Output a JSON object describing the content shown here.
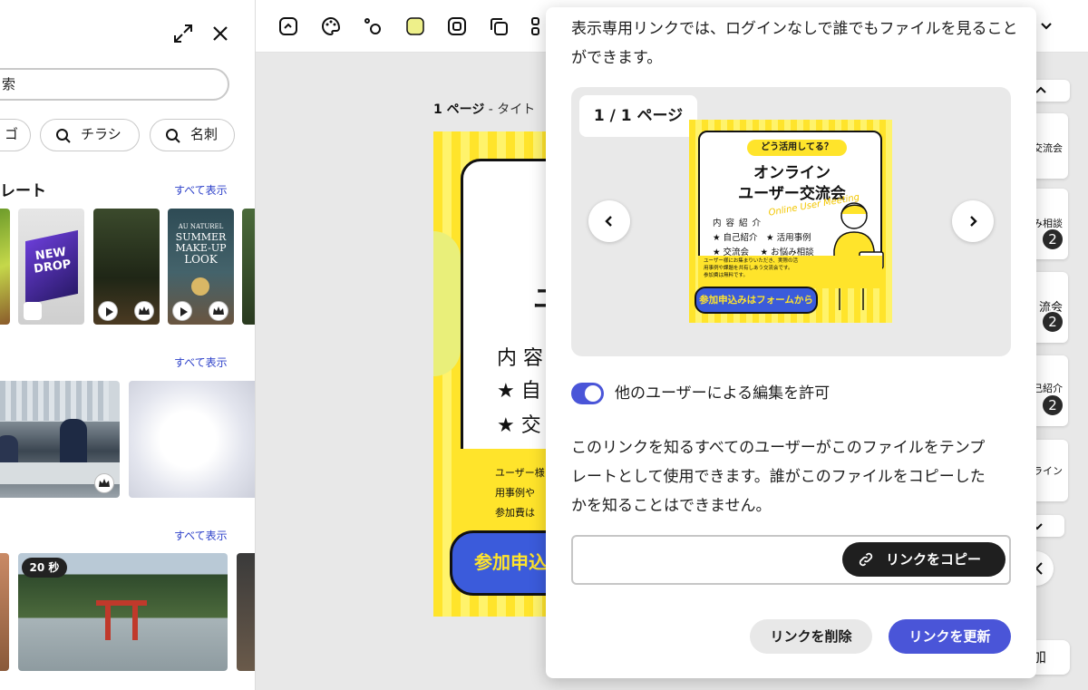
{
  "left_panel": {
    "search_value": "索",
    "chips": [
      "ゴ",
      "チラシ",
      "名刺"
    ],
    "sections": [
      {
        "title": "レート",
        "see_all": "すべて表示"
      },
      {
        "title": "",
        "see_all": "すべて表示"
      },
      {
        "title": "",
        "see_all": "すべて表示"
      }
    ],
    "thumbs": {
      "new_drop": "NEW DROP",
      "summer_1": "AU NATUREL",
      "summer_2": "SUMMER",
      "summer_3": "MAKE-UP",
      "summer_4": "LOOK",
      "video_duration": "20 秒"
    }
  },
  "canvas": {
    "page_label_bold": "1 ページ",
    "page_label_rest": " - タイト",
    "design_lines": [
      "内 容 紹",
      "★ 自",
      "★ 交"
    ],
    "design_small": [
      "ユーザー様",
      "用事例や",
      "参加費は"
    ],
    "design_button": "参加申込"
  },
  "pages_strip": {
    "items": [
      {
        "label": "ー交流会",
        "count": ""
      },
      {
        "label": "み相談",
        "count": "2"
      },
      {
        "label": "流会",
        "count": "2"
      },
      {
        "label": "己紹介",
        "count": "2"
      },
      {
        "label": "ライン",
        "count": ""
      }
    ],
    "add_label": "加"
  },
  "share_popover": {
    "intro_text": "表示専用リンクでは、ログインなしで誰でもファイルを見ることができます。",
    "page_indicator": "1 / 1 ページ",
    "flyer": {
      "tag": "どう活用してる？",
      "title_line1": "オンライン",
      "title_line2": "ユーザー交流会",
      "subtitle": "Online User Meeting",
      "section": "内 容 紹 介",
      "items_line1": "★ 自己紹介　★ 活用事例",
      "items_line2": "★ 交流会　 ★ お悩み相談",
      "desc_line1": "ユーザー様にお集まりいただき、実際の活",
      "desc_line2": "用事例や課題を共有しあう交流会です。",
      "desc_line3": "参加費は無料です。",
      "button": "参加申込みはフォームから"
    },
    "toggle_on": true,
    "toggle_label": "他のユーザーによる編集を許可",
    "template_text": "このリンクを知るすべてのユーザーがこのファイルをテンプレートとして使用できます。誰がこのファイルをコピーしたかを知ることはできません。",
    "link_value": "",
    "copy_button": "リンクをコピー",
    "delete_button": "リンクを削除",
    "update_button": "リンクを更新"
  },
  "colors": {
    "accent": "#4a55d8",
    "flyer_yellow": "#ffe42b",
    "flyer_blue": "#3b5bdb",
    "see_all_link": "#2b3fc9"
  },
  "icons": [
    "expand-icon",
    "close-icon",
    "search-icon",
    "play-icon",
    "crown-icon",
    "chevron-left-icon",
    "chevron-right-icon",
    "link-icon",
    "chevron-down-icon"
  ]
}
